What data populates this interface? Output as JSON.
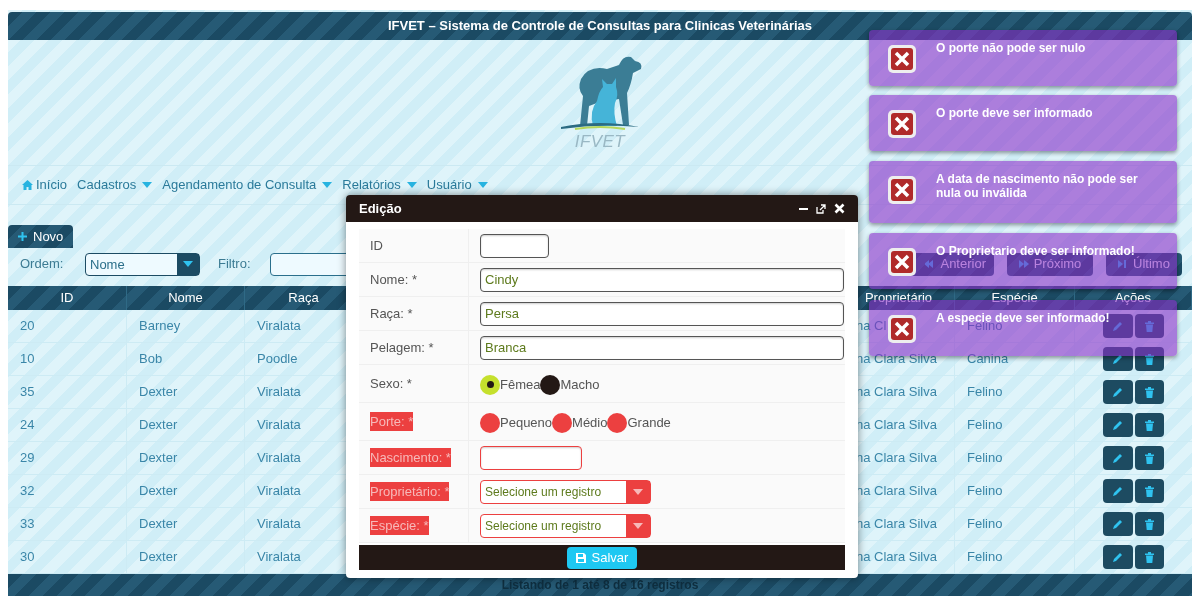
{
  "header": {
    "title": "IFVET – Sistema de Controle de Consultas para Clinicas Veterinárias",
    "logo_text": "IFVET"
  },
  "menu": [
    {
      "label": "Início",
      "kind": "home"
    },
    {
      "label": "Cadastros",
      "kind": "dropdown"
    },
    {
      "label": "Agendamento de Consulta",
      "kind": "dropdown"
    },
    {
      "label": "Relatórios",
      "kind": "dropdown"
    },
    {
      "label": "Usuário",
      "kind": "dropdown"
    }
  ],
  "toolbar": {
    "new_button": "Novo",
    "order_label": "Ordem:",
    "order_value": "Nome",
    "filter_label": "Filtro:"
  },
  "pagination": [
    {
      "label": "Anterior",
      "kind": "prev"
    },
    {
      "label": "Próximo",
      "kind": "next"
    },
    {
      "label": "Último",
      "kind": "last"
    }
  ],
  "table": {
    "columns": [
      "ID",
      "Nome",
      "Raça",
      "Proprietário",
      "Espécie",
      "Ações"
    ],
    "rows": [
      {
        "id": "20",
        "nome": "Barney",
        "raca": "Viralata",
        "proprietario": "na Cl",
        "especie": "Felino"
      },
      {
        "id": "10",
        "nome": "Bob",
        "raca": "Poodle",
        "proprietario": "na Clara Silva",
        "especie": "Canina"
      },
      {
        "id": "35",
        "nome": "Dexter",
        "raca": "Viralata",
        "proprietario": "na Clara Silva",
        "especie": "Felino"
      },
      {
        "id": "24",
        "nome": "Dexter",
        "raca": "Viralata",
        "proprietario": "na Clara Silva",
        "especie": "Felino"
      },
      {
        "id": "29",
        "nome": "Dexter",
        "raca": "Viralata",
        "proprietario": "na Clara Silva",
        "especie": "Felino"
      },
      {
        "id": "32",
        "nome": "Dexter",
        "raca": "Viralata",
        "proprietario": "na Clara Silva",
        "especie": "Felino"
      },
      {
        "id": "33",
        "nome": "Dexter",
        "raca": "Viralata",
        "proprietario": "na Clara Silva",
        "especie": "Felino"
      },
      {
        "id": "30",
        "nome": "Dexter",
        "raca": "Viralata",
        "proprietario": "na Clara Silva",
        "especie": "Felino"
      }
    ],
    "footer": "Listando de 1 até 8 de 16 registros"
  },
  "dialog": {
    "title": "Edição",
    "save_button": "Salvar",
    "fields": [
      {
        "label": "ID",
        "kind": "text",
        "error": false
      },
      {
        "label": "Nome: *",
        "kind": "text",
        "value": "Cindy",
        "error": false
      },
      {
        "label": "Raça: *",
        "kind": "text",
        "value": "Persa",
        "error": false
      },
      {
        "label": "Pelagem: *",
        "kind": "text",
        "value": "Branca",
        "error": false
      },
      {
        "label": "Sexo: *",
        "kind": "radio",
        "error": false,
        "options": [
          {
            "label": "Fêmea",
            "selected": true
          },
          {
            "label": "Macho",
            "selected": false
          }
        ]
      },
      {
        "label": "Porte: *",
        "kind": "radio",
        "error": true,
        "options": [
          {
            "label": "Pequeno",
            "selected": false
          },
          {
            "label": "Médio",
            "selected": false
          },
          {
            "label": "Grande",
            "selected": false
          }
        ]
      },
      {
        "label": "Nascimento: *",
        "kind": "text",
        "error": true
      },
      {
        "label": "Proprietário: *",
        "kind": "select",
        "value": "Selecione um registro",
        "error": true
      },
      {
        "label": "Espécie: *",
        "kind": "select",
        "value": "Selecione um registro",
        "error": true
      }
    ]
  },
  "notifications": [
    {
      "message": "O porte não pode ser nulo"
    },
    {
      "message": "O porte deve ser informado"
    },
    {
      "message": "A data de nascimento não pode ser nula ou inválida"
    },
    {
      "message": "O Proprietario deve ser informado!"
    },
    {
      "message": "A especie deve ser informado!"
    }
  ]
}
